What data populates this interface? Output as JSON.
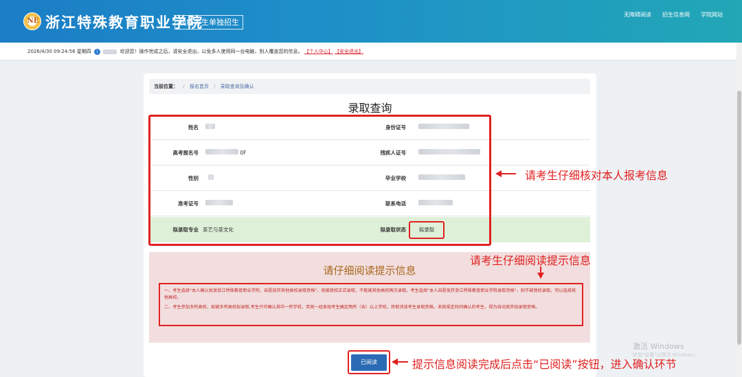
{
  "header": {
    "logo_text": "NE",
    "school_name": "浙江特殊教育职业学院",
    "sub_title": "残疾考生单独招生",
    "nav": [
      "无障碍阅读",
      "招生信息网",
      "学院网站"
    ]
  },
  "info_bar": {
    "datetime": "2026/4/30 09:24:56 星期四",
    "badge": "i",
    "message": "欢迎您！操作完成之后，请安全退出，以免多人使用同一台电脑，别人覆盖您的信息。",
    "personal_center": "【个人中心】",
    "logout": "【安全退出】"
  },
  "breadcrumb": {
    "label": "当前位置：",
    "items": [
      "报名首页",
      "录取查询及确认"
    ]
  },
  "page_title": "录取查询",
  "fields": {
    "name_label": "姓名",
    "id_label": "身份证号",
    "gaokao_label": "高考报名号",
    "gaokao_suffix": "0F",
    "disability_label": "残疾人证号",
    "gender_label": "性别",
    "school_label": "毕业学校",
    "exam_no_label": "准考证号",
    "phone_label": "联系电话",
    "major_label": "拟录取专业",
    "major_value": "茶艺与茶文化",
    "status_label": "拟录取状态",
    "status_value": "拟录取"
  },
  "notice": {
    "title": "请仔细阅读提示信息",
    "para1": "一、考生选择\"本人确认就读浙江特殊教育职业学院，自愿放弃其他高校录取资格\"，则被我校正式录取，不能被其他高校再次录取。考生选择\"本人自愿放弃浙江特殊教育职业学院录取资格\"，则不被我校录取，可以选择其他高校。",
    "para2": "二、考生参加多所高校，如被多所高校拟录取,考生只可确认其中一所学校，否则一经发现考生确定两所（含）以上学校，将取消该考生录取资格。未按规定时间确认的考生，视为自动放弃拟录取资格。"
  },
  "read_button": "已阅读",
  "annotations": {
    "check_info": "请考生仔细核对本人报考信息",
    "read_notice": "请考生仔细阅读提示信息",
    "click_read": "提示信息阅读完成后点击“已阅读”按钮，进入确认环节"
  },
  "watermark": {
    "line1": "激活 Windows",
    "line2": "转到\"设置\"以激活 Windows。"
  },
  "colors": {
    "header_start": "#1b7dc6",
    "header_end": "#22a7b6",
    "annotation_red": "#e02020",
    "button_blue": "#2b6bb5"
  }
}
